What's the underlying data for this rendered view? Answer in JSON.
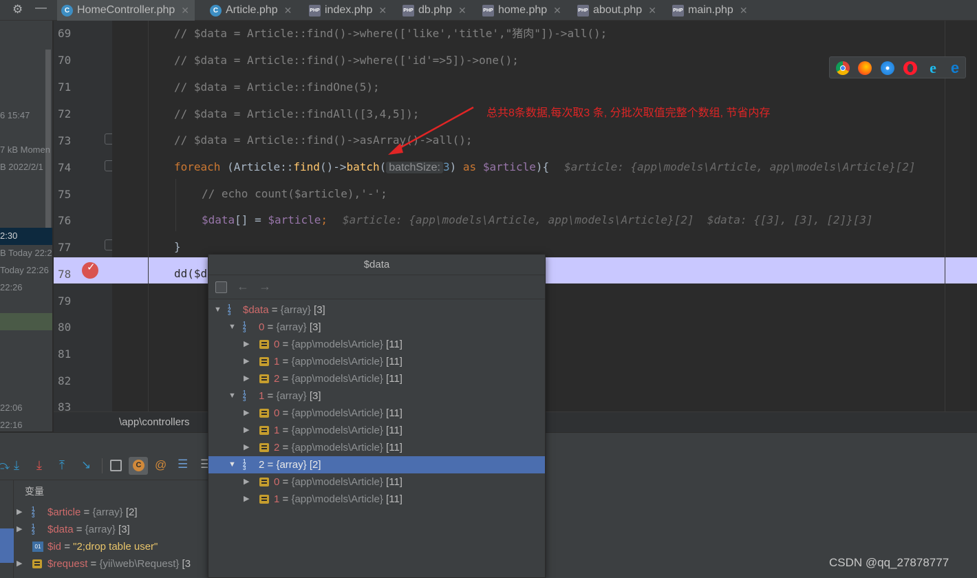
{
  "tabs": [
    {
      "label": "HomeController.php",
      "type": "class",
      "active": true
    },
    {
      "label": "Article.php",
      "type": "class",
      "active": false
    },
    {
      "label": "index.php",
      "type": "php",
      "active": false
    },
    {
      "label": "db.php",
      "type": "php",
      "active": false
    },
    {
      "label": "home.php",
      "type": "php",
      "active": false
    },
    {
      "label": "about.php",
      "type": "php",
      "active": false
    },
    {
      "label": "main.php",
      "type": "php",
      "active": false
    }
  ],
  "left_strip": [
    "6 15:47",
    "7 kB Momen",
    "B 2022/2/1",
    "2:30",
    "B Today 22:2",
    "Today 22:26",
    "22:26",
    "22:06",
    "22:16"
  ],
  "line_numbers": [
    "69",
    "70",
    "71",
    "72",
    "73",
    "74",
    "75",
    "76",
    "77",
    "78",
    "79",
    "80",
    "81",
    "82",
    "83"
  ],
  "code": {
    "l69": "// $data = Article::find()->where(['like','title',\"猪肉\"])->all();",
    "l70": "// $data = Article::find()->where(['id'=>5])->one();",
    "l71": "// $data = Article::findOne(5);",
    "l72": "// $data = Article::findAll([3,4,5]);",
    "l73": "// $data = Article::find()->asArray()->all();",
    "l74_kw": "foreach",
    "l74_a": " (Article::",
    "l74_find": "find",
    "l74_b": "()->",
    "l74_batch": "batch",
    "l74_c": "(",
    "l74_hint": "batchSize:",
    "l74_num": "3",
    "l74_d": ") ",
    "l74_as": "as",
    "l74_e": " ",
    "l74_var": "$article",
    "l74_f": "){",
    "l74_inline": "$article: {app\\models\\Article, app\\models\\Article}[2]",
    "l75": "// echo count($article),'-';",
    "l76_a": "$data",
    "l76_b": "[] = ",
    "l76_c": "$article",
    "l76_d": ";",
    "l76_inline": "$article: {app\\models\\Article, app\\models\\Article}[2]  $data: {[3], [3], [2]}[3]",
    "l77": "}",
    "l78": "dd($d"
  },
  "annotation": "总共8条数据,每次取3 条, 分批次取值完整个数组, 节省内存",
  "breadcrumb": "\\app\\controllers",
  "variables_panel": {
    "header": "变量",
    "rows": [
      {
        "name": "$article",
        "eq": " = ",
        "type": "{array}",
        "count": " [2]"
      },
      {
        "name": "$data",
        "eq": " = ",
        "type": "{array}",
        "count": " [3]"
      },
      {
        "name": "$id",
        "eq": " = ",
        "value": "\"2;drop table user\""
      },
      {
        "name": "$request",
        "eq": " = ",
        "type": "{yii\\web\\Request}",
        "count": " [3"
      }
    ]
  },
  "popup": {
    "title": "$data",
    "rows": [
      {
        "name": "$data",
        "type": "{array}",
        "count": "[3]"
      },
      {
        "name": "0",
        "type": "{array}",
        "count": "[3]"
      },
      {
        "name": "0",
        "type": "{app\\models\\Article}",
        "count": "[11]"
      },
      {
        "name": "1",
        "type": "{app\\models\\Article}",
        "count": "[11]"
      },
      {
        "name": "2",
        "type": "{app\\models\\Article}",
        "count": "[11]"
      },
      {
        "name": "1",
        "type": "{array}",
        "count": "[3]"
      },
      {
        "name": "0",
        "type": "{app\\models\\Article}",
        "count": "[11]"
      },
      {
        "name": "1",
        "type": "{app\\models\\Article}",
        "count": "[11]"
      },
      {
        "name": "2",
        "type": "{app\\models\\Article}",
        "count": "[11]"
      },
      {
        "name": "2",
        "type": "{array}",
        "count": "[2]"
      },
      {
        "name": "0",
        "type": "{app\\models\\Article}",
        "count": "[11]"
      },
      {
        "name": "1",
        "type": "{app\\models\\Article}",
        "count": "[11]"
      }
    ],
    "eq": " = "
  },
  "browser_icons": [
    "chrome-icon",
    "firefox-icon",
    "safari-icon",
    "opera-icon",
    "ie-icon",
    "edge-icon"
  ],
  "watermark": "CSDN @qq_27878777",
  "colors": {
    "selection": "#4b6eaf",
    "highlight_line": "#c9c8ff",
    "annotation": "#e02525"
  }
}
